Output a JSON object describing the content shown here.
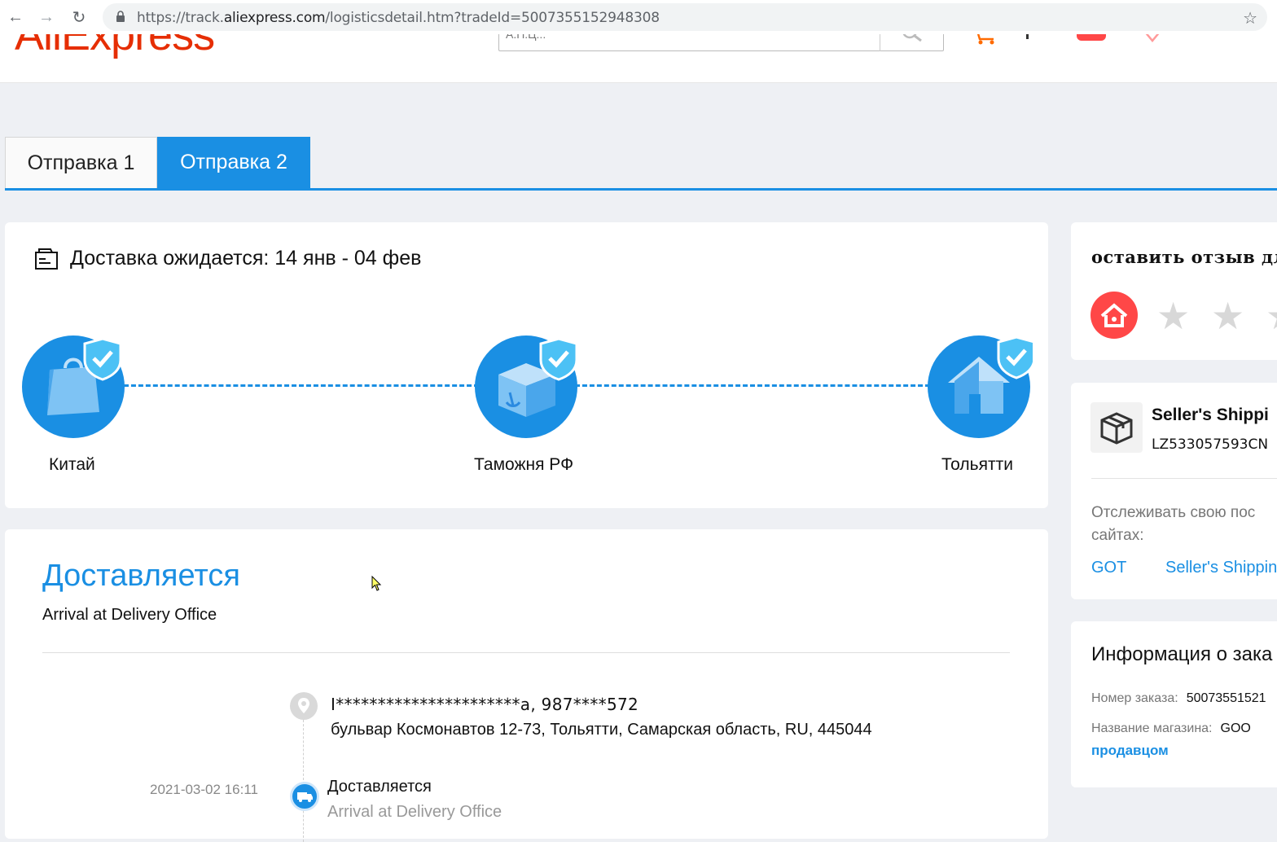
{
  "browser": {
    "url_prefix": "https://track.",
    "url_domain": "aliexpress.com",
    "url_path": "/logisticsdetail.htm?tradeId=5007355152948308"
  },
  "header": {
    "logo": "AliExpress",
    "search_placeholder": "А.П.Ц..."
  },
  "tabs": [
    {
      "label": "Отправка 1",
      "active": false
    },
    {
      "label": "Отправка 2",
      "active": true
    }
  ],
  "route": {
    "eta": "Доставка ожидается: 14 янв - 04 фев",
    "nodes": [
      {
        "label": "Китай"
      },
      {
        "label": "Таможня РФ"
      },
      {
        "label": "Тольятти"
      }
    ]
  },
  "status": {
    "title": "Доставляется",
    "subtitle": "Arrival at Delivery Office",
    "address_line1": "I**********************a,  987****572",
    "address_line2": "бульвар Космонавтов 12-73,  Тольятти,  Самарская область,  RU,  445044",
    "event_time": "2021-03-02 16:11",
    "event_title": "Доставляется",
    "event_sub": "Arrival at Delivery Office"
  },
  "side": {
    "review_title": "оставить отзыв для с",
    "shipping_name": "Seller's Shippi",
    "tracking_number": "LZ533057593CN",
    "track_text": "Отслеживать свою пос сайтах:",
    "link_got": "GOT",
    "link_seller": "Seller's Shippin",
    "info_title": "Информация о зака",
    "order_label": "Номер заказа:",
    "order_value": "50073551521",
    "store_label": "Название магазина:",
    "store_value": "GOO",
    "contact_link": "продавцом"
  },
  "colors": {
    "accent": "#1a8fe3",
    "brand": "#e62e04",
    "review_red": "#ff4747"
  }
}
